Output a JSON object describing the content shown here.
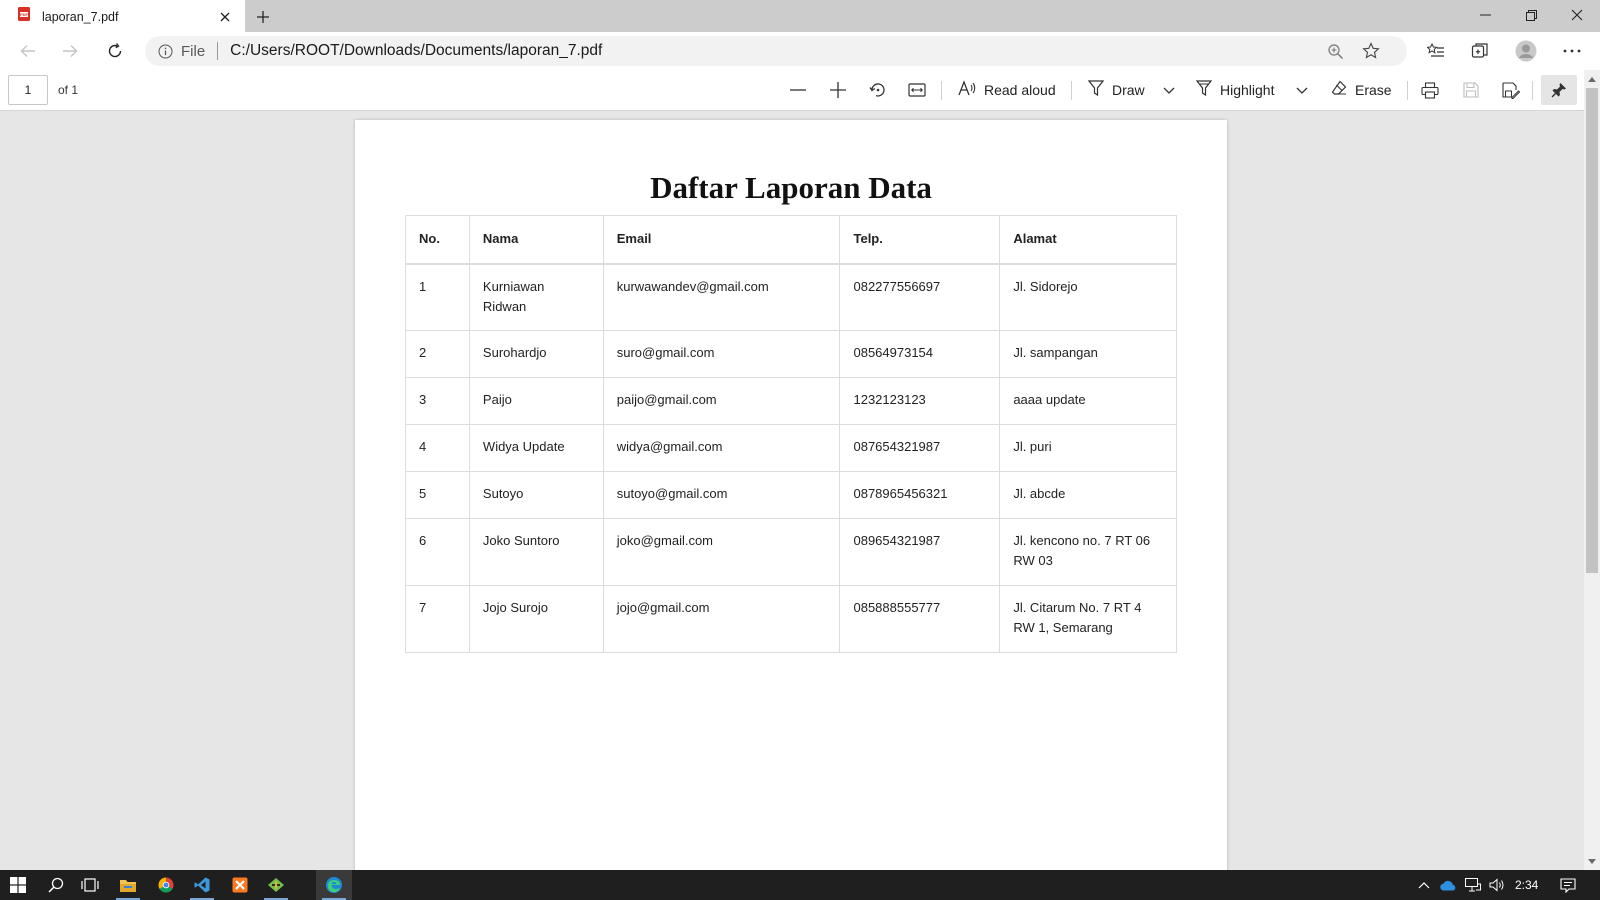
{
  "tab": {
    "title": "laporan_7.pdf",
    "icon": "pdf-file-icon"
  },
  "address": {
    "scheme": "File",
    "url": "C:/Users/ROOT/Downloads/Documents/laporan_7.pdf"
  },
  "pdf_toolbar": {
    "page_current": "1",
    "page_of": "of 1",
    "read_aloud": "Read aloud",
    "draw": "Draw",
    "highlight": "Highlight",
    "erase": "Erase"
  },
  "document": {
    "title": "Daftar Laporan Data",
    "columns": [
      "No.",
      "Nama",
      "Email",
      "Telp.",
      "Alamat"
    ],
    "rows": [
      [
        "1",
        "Kurniawan Ridwan",
        "kurwawandev@gmail.com",
        "082277556697",
        "Jl. Sidorejo"
      ],
      [
        "2",
        "Surohardjo",
        "suro@gmail.com",
        "08564973154",
        "Jl. sampangan"
      ],
      [
        "3",
        "Paijo",
        "paijo@gmail.com",
        "1232123123",
        "aaaa update"
      ],
      [
        "4",
        "Widya Update",
        "widya@gmail.com",
        "087654321987",
        "Jl. puri"
      ],
      [
        "5",
        "Sutoyo",
        "sutoyo@gmail.com",
        "0878965456321",
        "Jl. abcde"
      ],
      [
        "6",
        "Joko Suntoro",
        "joko@gmail.com",
        "089654321987",
        "Jl. kencono no. 7 RT 06 RW 03"
      ],
      [
        "7",
        "Jojo Surojo",
        "jojo@gmail.com",
        "085888555777",
        "Jl. Citarum No. 7 RT 4 RW 1, Semarang"
      ]
    ]
  },
  "taskbar": {
    "time": "2:34"
  },
  "colors": {
    "tabstrip": "#cccccc",
    "viewer_bg": "#e6e6e6",
    "taskbar": "#1f1f1f",
    "pdf_red": "#d93025"
  }
}
